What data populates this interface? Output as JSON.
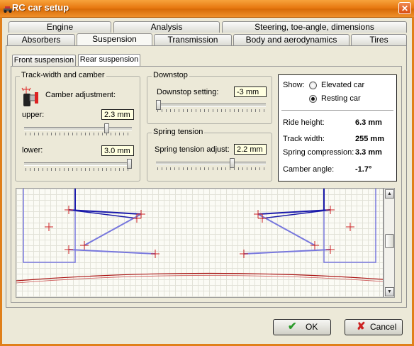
{
  "window": {
    "title": "RC car setup",
    "close_glyph": "✕"
  },
  "tabs_row1": [
    {
      "label": "Engine"
    },
    {
      "label": "Analysis"
    },
    {
      "label": "Steering, toe-angle, dimensions"
    }
  ],
  "tabs_row2": [
    {
      "label": "Absorbers"
    },
    {
      "label": "Suspension"
    },
    {
      "label": "Transmission"
    },
    {
      "label": "Body and aerodynamics"
    },
    {
      "label": "Tires"
    }
  ],
  "active_tab": "Suspension",
  "subtabs": [
    {
      "label": "Front suspension"
    },
    {
      "label": "Rear suspension"
    }
  ],
  "active_subtab": "Rear suspension",
  "track_camber": {
    "title": "Track-width and camber",
    "camber_label": "Camber adjustment:",
    "upper_label": "upper:",
    "upper_value": "2.3 mm",
    "upper_level": 0.78,
    "lower_label": "lower:",
    "lower_value": "3.0 mm",
    "lower_level": 1.0
  },
  "downstop": {
    "title": "Downstop",
    "label": "Downstop setting:",
    "value": "-3 mm",
    "level": 0.0
  },
  "spring": {
    "title": "Spring tension",
    "label": "Spring tension adjust:",
    "value": "2.2 mm",
    "level": 0.7
  },
  "info": {
    "show_label": "Show:",
    "options": [
      "Elevated car",
      "Resting car"
    ],
    "selected": "Resting car",
    "rows": [
      {
        "label": "Ride height:",
        "value": "6.3 mm"
      },
      {
        "label": "Track width:",
        "value": "255 mm"
      },
      {
        "label": "Spring compression:",
        "value": "3.3 mm"
      },
      {
        "label": "Camber angle:",
        "value": "-1.7°"
      }
    ]
  },
  "scroll": {
    "up": "▲",
    "down": "▼"
  },
  "buttons": {
    "ok": "OK",
    "cancel": "Cancel",
    "ok_icon": "✔",
    "cancel_icon": "✘"
  },
  "colors": {
    "accent": "#e87a12",
    "arm_dark": "#1a1aaa",
    "arm_light": "#7777dd",
    "marker": "#cc2222",
    "ground": "#aa1111"
  },
  "icons": [
    "camber-icon",
    "check-icon",
    "cross-icon",
    "close-icon"
  ]
}
